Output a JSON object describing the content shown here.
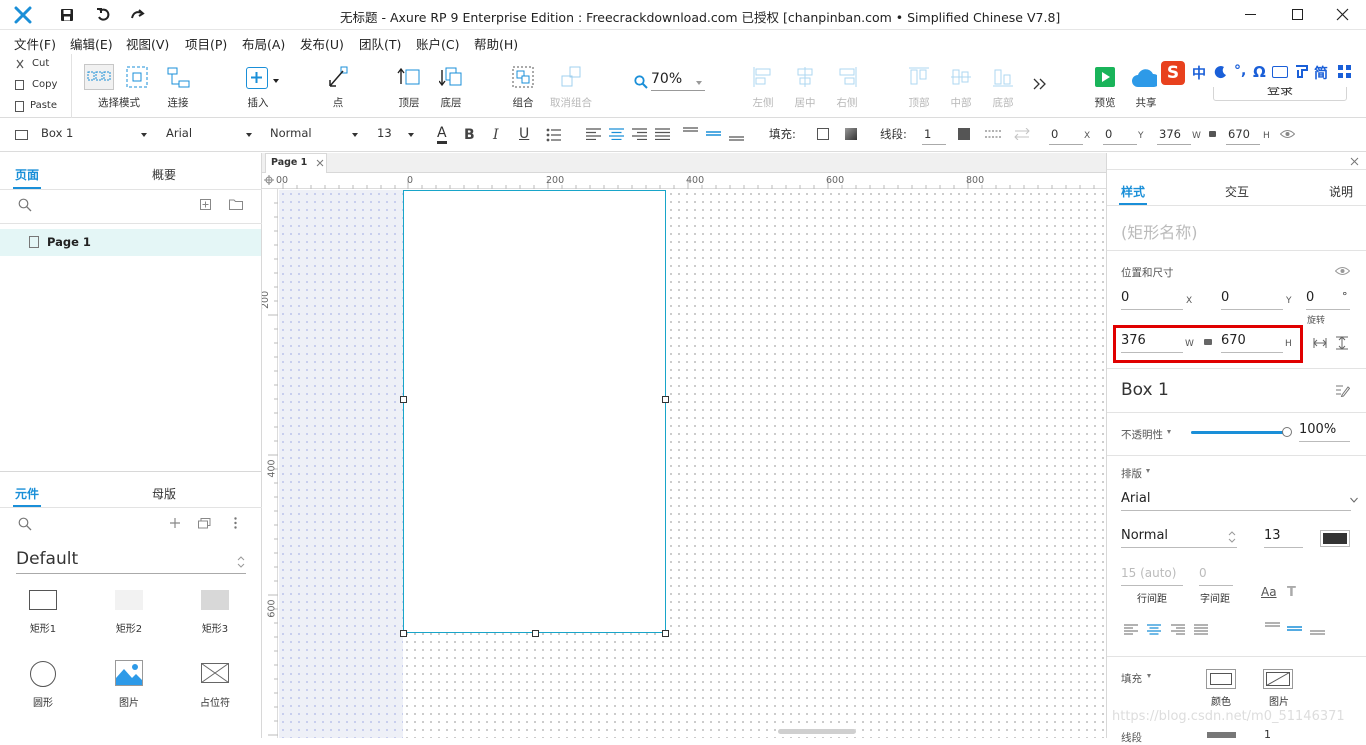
{
  "window": {
    "title": "无标题 - Axure RP 9 Enterprise Edition : Freecrackdownload.com 已授权     [chanpinban.com • Simplified Chinese V7.8]"
  },
  "menu": [
    "文件(F)",
    "编辑(E)",
    "视图(V)",
    "项目(P)",
    "布局(A)",
    "发布(U)",
    "团队(T)",
    "账户(C)",
    "帮助(H)"
  ],
  "clipboard": {
    "cut": "Cut",
    "copy": "Copy",
    "paste": "Paste"
  },
  "toolbar": {
    "select_mode": "选择模式",
    "connect": "连接",
    "insert": "插入",
    "point": "点",
    "to_front": "顶层",
    "to_back": "底层",
    "group": "组合",
    "ungroup": "取消组合",
    "zoom": "70%",
    "align_left": "左侧",
    "align_center": "居中",
    "align_right": "右侧",
    "align_top": "顶部",
    "align_middle": "中部",
    "align_bottom": "底部",
    "preview": "预览",
    "share": "共享",
    "login": "登录"
  },
  "ime": {
    "brand": "S",
    "chinese": "中",
    "simplified": "简"
  },
  "format": {
    "widget_name": "Box 1",
    "font": "Arial",
    "weight": "Normal",
    "size": "13",
    "fill_label": "填充:",
    "stroke_label": "线段:",
    "stroke_value": "1",
    "x": "0",
    "y": "0",
    "w": "376",
    "h": "670",
    "x_unit": "X",
    "y_unit": "Y",
    "w_unit": "W",
    "h_unit": "H"
  },
  "left": {
    "pages_tab": "页面",
    "outline_tab": "概要",
    "page_item": "Page 1",
    "library_tab": "元件",
    "masters_tab": "母版",
    "library_name": "Default",
    "widgets": [
      {
        "label": "矩形1",
        "icon": "rectangle1-icon"
      },
      {
        "label": "矩形2",
        "icon": "rectangle2-icon"
      },
      {
        "label": "矩形3",
        "icon": "rectangle3-icon"
      },
      {
        "label": "圆形",
        "icon": "circle-icon"
      },
      {
        "label": "图片",
        "icon": "image-icon"
      },
      {
        "label": "占位符",
        "icon": "placeholder-icon"
      }
    ]
  },
  "canvas": {
    "tab": "Page 1",
    "ruler_top": [
      "00",
      "0",
      "200",
      "400",
      "600",
      "800"
    ],
    "ruler_left": [
      "200",
      "400",
      "600"
    ]
  },
  "right": {
    "tabs": {
      "style": "样式",
      "interaction": "交互",
      "notes": "说明"
    },
    "shape_name_placeholder": "(矩形名称)",
    "position_size_label": "位置和尺寸",
    "x": "0",
    "y": "0",
    "rotation": "0",
    "rotation_unit": "°",
    "rotation_label": "旋转",
    "w": "376",
    "h": "670",
    "x_unit": "X",
    "y_unit": "Y",
    "w_unit": "W",
    "h_unit": "H",
    "widget_name": "Box 1",
    "opacity_label": "不透明性",
    "opacity": "100%",
    "opacity_fraction": 1.0,
    "typography_label": "排版",
    "font": "Arial",
    "weight": "Normal",
    "size": "13",
    "line_spacing": "15 (auto)",
    "char_spacing": "0",
    "line_spacing_label": "行间距",
    "char_spacing_label": "字间距",
    "text_glyph": "Aa",
    "fill_label": "填充",
    "fill_color_label": "颜色",
    "fill_image_label": "图片",
    "stroke_label": "线段",
    "stroke_value": "1",
    "watermark": "https://blog.csdn.net/m0_51146371",
    "highlight_color": "#e00000"
  },
  "colors": {
    "accent": "#1a8fd8",
    "selection": "#18a5c9",
    "font_color": "#333333"
  }
}
